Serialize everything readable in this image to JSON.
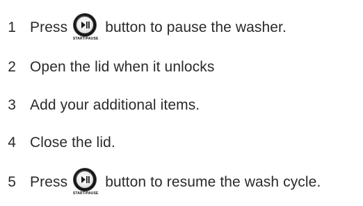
{
  "steps": [
    {
      "number": "1",
      "before": "Press",
      "button_caption": "START/PAUSE",
      "after": "button to pause the washer."
    },
    {
      "number": "2",
      "text": "Open the lid when it unlocks"
    },
    {
      "number": "3",
      "text": "Add your additional items."
    },
    {
      "number": "4",
      "text": "Close the lid."
    },
    {
      "number": "5",
      "before": "Press",
      "button_caption": "START/PAUSE",
      "after": "button to resume the wash cycle."
    }
  ],
  "icons": {
    "start_pause": "play-pause-icon"
  },
  "colors": {
    "text": "#2a2a2a",
    "button_body": "#1a1a1a",
    "button_face": "#f2f2f2"
  }
}
